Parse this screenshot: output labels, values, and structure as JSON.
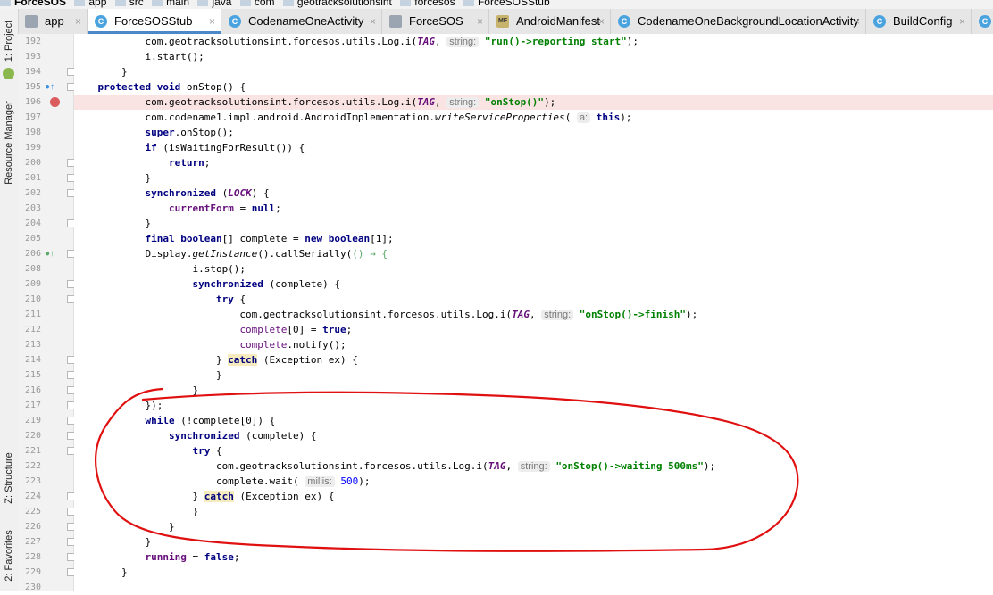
{
  "breadcrumb": [
    "ForceSOS",
    "app",
    "src",
    "main",
    "java",
    "com",
    "geotracksolutionsint",
    "forcesos",
    "ForceSOSStub"
  ],
  "tabs": [
    {
      "label": "app",
      "icon": "module",
      "active": false
    },
    {
      "label": "ForceSOSStub",
      "icon": "class",
      "active": true
    },
    {
      "label": "CodenameOneActivity",
      "icon": "class",
      "active": false
    },
    {
      "label": "ForceSOS",
      "icon": "module",
      "active": false
    },
    {
      "label": "AndroidManifest",
      "icon": "manifest",
      "active": false
    },
    {
      "label": "CodenameOneBackgroundLocationActivity",
      "icon": "class",
      "active": false
    },
    {
      "label": "BuildConfig",
      "icon": "class",
      "active": false
    },
    {
      "label": "C",
      "icon": "class",
      "active": false
    }
  ],
  "tab_close_glyph": "×",
  "class_glyph": "C",
  "manifest_glyph": "MF",
  "side_panels": [
    "1: Project",
    "Resource Manager",
    "Z: Structure",
    "2: Favorites"
  ],
  "hints": {
    "string": "string:",
    "a": "a:",
    "millis": "millis:"
  },
  "line_numbers": [
    "192",
    "193",
    "194",
    "195",
    "196",
    "197",
    "198",
    "199",
    "200",
    "201",
    "202",
    "203",
    "204",
    "205",
    "206",
    "208",
    "209",
    "210",
    "211",
    "212",
    "213",
    "214",
    "215",
    "216",
    "217",
    "219",
    "220",
    "221",
    "222",
    "223",
    "224",
    "225",
    "226",
    "227",
    "228",
    "229",
    "230"
  ],
  "code": {
    "l192": {
      "pre": "            com.geotracksolutionsint.forcesos.utils.Log.i(",
      "tag": "TAG",
      "mid": ", ",
      "str": "\"run()->reporting start\"",
      "post": ");"
    },
    "l193": "            i.start();",
    "l194": "        }",
    "l195": {
      "kw": "protected void",
      "rest": " onStop() {"
    },
    "l196": {
      "pre": "            com.geotracksolutionsint.forcesos.utils.Log.i(",
      "tag": "TAG",
      "mid": ", ",
      "str": "\"onStop()\"",
      "post": ");"
    },
    "l197": {
      "pre": "            com.codename1.impl.android.AndroidImplementation.",
      "method": "writeServiceProperties",
      "mid": "( ",
      "kw": "this",
      "post": ");"
    },
    "l198": {
      "kw": "super",
      "rest": ".onStop();"
    },
    "l199": {
      "kw": "if",
      "rest": " (isWaitingForResult()) {"
    },
    "l200": {
      "kw": "return",
      "rest": ";"
    },
    "l201": "            }",
    "l202": {
      "kw": "synchronized",
      "mid": " (",
      "ital": "LOCK",
      "rest": ") {"
    },
    "l203": {
      "fld": "currentForm",
      "mid": " = ",
      "kw": "null",
      "rest": ";"
    },
    "l204": "            }",
    "l205": {
      "kw1": "final boolean",
      "mid": "[] complete = ",
      "kw2": "new boolean",
      "rest": "[1];"
    },
    "l206": {
      "pre": "            Display.",
      "ital": "getInstance",
      "mid": "().callSerially(",
      "lambda": "() → {"
    },
    "l208": "                    i.stop();",
    "l209": {
      "kw": "synchronized",
      "rest": " (complete) {"
    },
    "l210": {
      "kw": "try",
      "rest": " {"
    },
    "l211": {
      "pre": "                            com.geotracksolutionsint.forcesos.utils.Log.i(",
      "tag": "TAG",
      "mid": ", ",
      "str": "\"onStop()->finish\"",
      "post": ");"
    },
    "l212": {
      "fld": "complete",
      "mid": "[0] = ",
      "kw": "true",
      "rest": ";"
    },
    "l213": {
      "fld": "complete",
      "rest": ".notify();"
    },
    "l214": {
      "pre": "                        } ",
      "kw": "catch",
      "rest": " (Exception ex) {"
    },
    "l215": "                        }",
    "l216": "                    }",
    "l217": "            });",
    "l219": {
      "kw": "while",
      "rest": " (!complete[0]) {"
    },
    "l220": {
      "kw": "synchronized",
      "rest": " (complete) {"
    },
    "l221": {
      "kw": "try",
      "rest": " {"
    },
    "l222": {
      "pre": "                        com.geotracksolutionsint.forcesos.utils.Log.i(",
      "tag": "TAG",
      "mid": ", ",
      "str": "\"onStop()->waiting 500ms\"",
      "post": ");"
    },
    "l223": {
      "pre": "                        complete.wait( ",
      "num": "500",
      "post": ");"
    },
    "l224": {
      "pre": "                    } ",
      "kw": "catch",
      "rest": " (Exception ex) {"
    },
    "l225": "                    }",
    "l226": "                }",
    "l227": "            }",
    "l228": {
      "fld": "running",
      "mid": " = ",
      "kw": "false",
      "rest": ";"
    },
    "l229": "        }"
  },
  "colors": {
    "keyword": "#000080",
    "string": "#008000",
    "field": "#660e7a",
    "number": "#0000ff",
    "breakpoint": "#db5c5c",
    "highlight_line": "#fae3e3",
    "annotation": "#e01010"
  }
}
